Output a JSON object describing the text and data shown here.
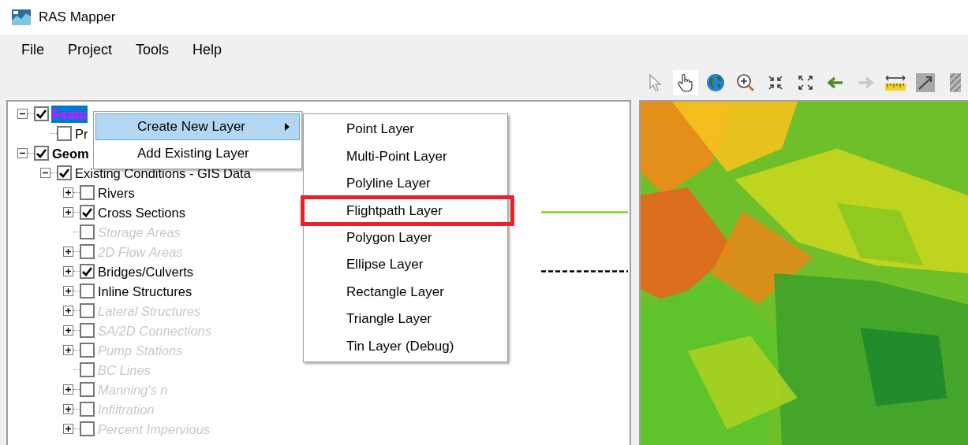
{
  "window": {
    "title": "RAS Mapper"
  },
  "menu_bar": [
    "File",
    "Project",
    "Tools",
    "Help"
  ],
  "toolbar": [
    {
      "kind": "pointer",
      "selected": false,
      "disabled": false
    },
    {
      "kind": "hand",
      "selected": true,
      "disabled": false
    },
    {
      "kind": "globe",
      "selected": false,
      "disabled": false
    },
    {
      "kind": "zoom-in",
      "selected": false,
      "disabled": false
    },
    {
      "kind": "shrink",
      "selected": false,
      "disabled": false
    },
    {
      "kind": "expand",
      "selected": false,
      "disabled": false
    },
    {
      "kind": "back",
      "selected": false,
      "disabled": false
    },
    {
      "kind": "forward",
      "selected": false,
      "disabled": true
    },
    {
      "kind": "ruler",
      "selected": false,
      "disabled": false
    },
    {
      "kind": "profile",
      "selected": false,
      "disabled": false
    },
    {
      "kind": "hatch",
      "selected": false,
      "disabled": false
    }
  ],
  "tree": [
    {
      "label": "Featu",
      "kind": "branch",
      "expanded": true,
      "checked": true,
      "selected": true,
      "bold": true,
      "disabled": false,
      "children": [
        {
          "label": "Pr",
          "kind": "leaf",
          "checked": false,
          "selected": false,
          "bold": false,
          "disabled": false
        }
      ]
    },
    {
      "label": "Geom",
      "kind": "branch",
      "expanded": true,
      "checked": true,
      "selected": false,
      "bold": true,
      "disabled": false,
      "children": [
        {
          "label": "Existing Conditions - GIS Data",
          "kind": "branch",
          "expanded": true,
          "checked": true,
          "selected": false,
          "bold": false,
          "disabled": false,
          "children": [
            {
              "label": "Rivers",
              "kind": "branch",
              "expanded": false,
              "checked": false,
              "selected": false,
              "bold": false,
              "disabled": false
            },
            {
              "label": "Cross Sections",
              "kind": "branch",
              "expanded": false,
              "checked": true,
              "selected": false,
              "bold": false,
              "disabled": false,
              "legend": {
                "kind": "solid",
                "color": "#7ed321"
              }
            },
            {
              "label": "Storage Areas",
              "kind": "leaf",
              "checked": false,
              "selected": false,
              "bold": false,
              "disabled": true
            },
            {
              "label": "2D Flow Areas",
              "kind": "branch",
              "expanded": false,
              "checked": false,
              "selected": false,
              "bold": false,
              "disabled": true
            },
            {
              "label": "Bridges/Culverts",
              "kind": "branch",
              "expanded": false,
              "checked": true,
              "selected": false,
              "bold": false,
              "disabled": false,
              "legend": {
                "kind": "dashed",
                "color": "#000000"
              }
            },
            {
              "label": "Inline Structures",
              "kind": "branch",
              "expanded": false,
              "checked": false,
              "selected": false,
              "bold": false,
              "disabled": false
            },
            {
              "label": "Lateral Structures",
              "kind": "branch",
              "expanded": false,
              "checked": false,
              "selected": false,
              "bold": false,
              "disabled": true
            },
            {
              "label": "SA/2D Connections",
              "kind": "branch",
              "expanded": false,
              "checked": false,
              "selected": false,
              "bold": false,
              "disabled": true
            },
            {
              "label": "Pump Stations",
              "kind": "branch",
              "expanded": false,
              "checked": false,
              "selected": false,
              "bold": false,
              "disabled": true
            },
            {
              "label": "BC Lines",
              "kind": "leaf",
              "checked": false,
              "selected": false,
              "bold": false,
              "disabled": true
            },
            {
              "label": "Manning's n",
              "kind": "branch",
              "expanded": false,
              "checked": false,
              "selected": false,
              "bold": false,
              "disabled": true
            },
            {
              "label": "Infiltration",
              "kind": "branch",
              "expanded": false,
              "checked": false,
              "selected": false,
              "bold": false,
              "disabled": true
            },
            {
              "label": "Percent Impervious",
              "kind": "branch",
              "expanded": false,
              "checked": false,
              "selected": false,
              "bold": false,
              "disabled": true
            }
          ]
        }
      ]
    }
  ],
  "context_menu": [
    {
      "label": "Create New Layer",
      "kind": "submenu",
      "selected": true
    },
    {
      "label": "Add Existing Layer",
      "kind": "item",
      "selected": false
    }
  ],
  "submenu": [
    {
      "label": "Point Layer",
      "highlighted": false
    },
    {
      "label": "Multi-Point Layer",
      "highlighted": false
    },
    {
      "label": "Polyline Layer",
      "highlighted": false
    },
    {
      "label": "Flightpath Layer",
      "highlighted": true
    },
    {
      "label": "Polygon Layer",
      "highlighted": false
    },
    {
      "label": "Ellipse Layer",
      "highlighted": false
    },
    {
      "label": "Rectangle Layer",
      "highlighted": false
    },
    {
      "label": "Triangle Layer",
      "highlighted": false
    },
    {
      "label": "Tin Layer (Debug)",
      "highlighted": false
    }
  ]
}
